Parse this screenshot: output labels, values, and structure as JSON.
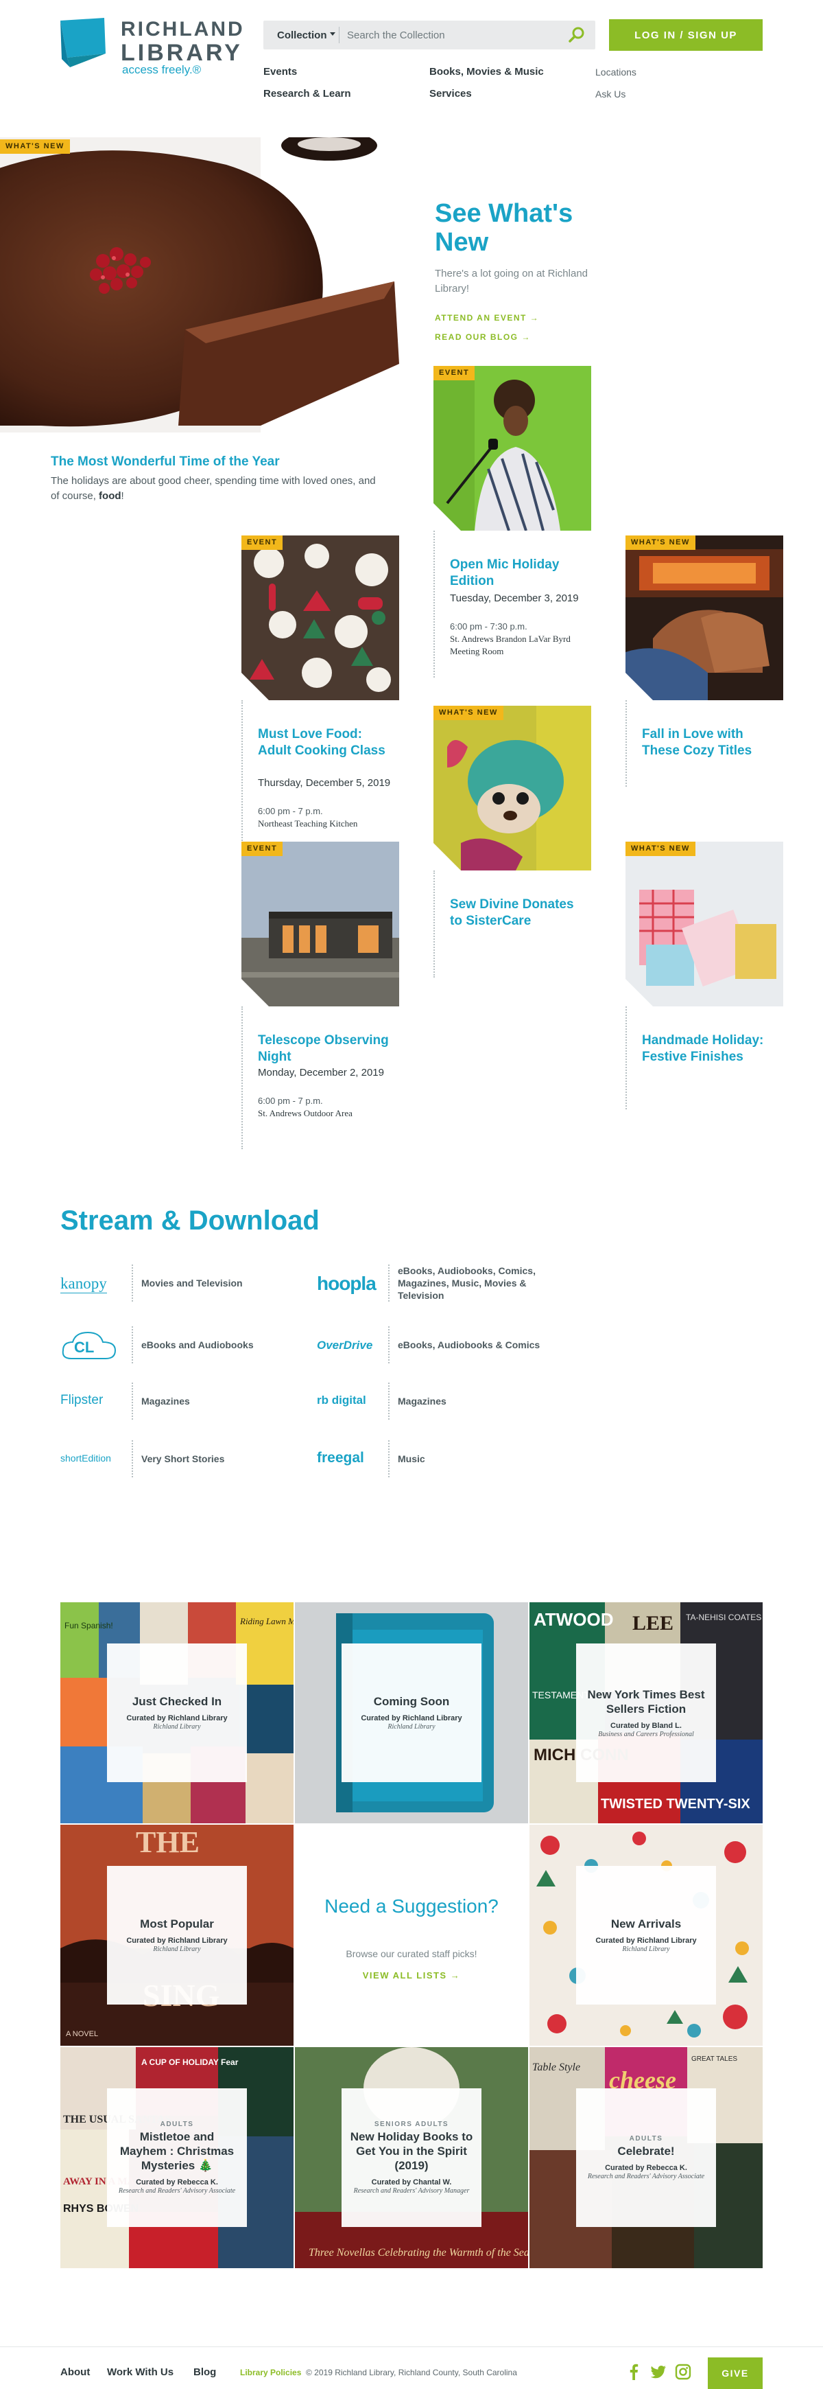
{
  "brand": {
    "name_line1": "RICHLAND",
    "name_line2": "LIBRARY",
    "tagline": "access freely.®",
    "colors": {
      "teal": "#1aa3c6",
      "green": "#8cbc26",
      "badge": "#f2b71b",
      "text": "#2f3a3e"
    }
  },
  "search": {
    "scope_label": "Collection",
    "placeholder": "Search the Collection",
    "icon": "search-icon"
  },
  "login_label": "LOG IN / SIGN UP",
  "nav": {
    "primary": [
      "Events",
      "Books, Movies & Music",
      "Research & Learn",
      "Services"
    ],
    "utility": [
      "Locations",
      "Ask Us"
    ]
  },
  "hero": {
    "badge": "WHAT'S NEW",
    "title": "The Most Wonderful Time of the Year",
    "desc_before": "The holidays are about good cheer, spending time with loved ones, and of course, ",
    "desc_bold": "food",
    "desc_after": "!"
  },
  "see_whats_new": {
    "title": "See What's New",
    "desc": "There's a lot going on at Richland Library!",
    "links": [
      "ATTEND AN EVENT →",
      "READ OUR BLOG →"
    ]
  },
  "cards": [
    {
      "badge": "EVENT",
      "title": "Open Mic Holiday Edition",
      "date": "Tuesday, December 3, 2019",
      "time": "6:00 pm - 7:30 p.m.",
      "location": "St. Andrews Brandon LaVar Byrd Meeting Room"
    },
    {
      "badge": "EVENT",
      "title": "Must Love Food: Adult Cooking Class",
      "date": "Thursday, December 5, 2019",
      "time": "6:00 pm - 7 p.m.",
      "location": "Northeast Teaching Kitchen"
    },
    {
      "badge": "WHAT'S NEW",
      "title": "Fall in Love with These Cozy Titles"
    },
    {
      "badge": "WHAT'S NEW",
      "title": "Sew Divine Donates to SisterCare"
    },
    {
      "badge": "EVENT",
      "title": "Telescope Observing Night",
      "date": "Monday, December 2, 2019",
      "time": "6:00 pm - 7 p.m.",
      "location": "St. Andrews Outdoor Area"
    },
    {
      "badge": "WHAT'S NEW",
      "title": "Handmade Holiday: Festive Finishes"
    }
  ],
  "stream": {
    "title": "Stream & Download",
    "services": [
      {
        "name": "kanopy",
        "desc": "Movies and Television"
      },
      {
        "name": "hoopla",
        "desc": "eBooks, Audiobooks, Comics, Magazines, Music, Movies & Television"
      },
      {
        "name": "CL",
        "desc": "eBooks and Audiobooks"
      },
      {
        "name": "OverDrive",
        "desc": "eBooks, Audiobooks & Comics"
      },
      {
        "name": "Flipster",
        "desc": "Magazines"
      },
      {
        "name": "rb digital",
        "desc": "Magazines"
      },
      {
        "name": "shortEdition",
        "desc": "Very Short Stories"
      },
      {
        "name": "freegal",
        "desc": "Music"
      }
    ]
  },
  "lists": [
    {
      "title": "Just Checked In",
      "curator": "Curated by Richland Library",
      "role": "Richland Library"
    },
    {
      "title": "Coming Soon",
      "curator": "Curated by Richland Library",
      "role": "Richland Library"
    },
    {
      "title": "New York Times Best Sellers Fiction",
      "curator": "Curated by Bland L.",
      "role": "Business and Careers Professional"
    },
    {
      "title": "Most Popular",
      "curator": "Curated by Richland Library",
      "role": "Richland Library"
    },
    {
      "title": "New Arrivals",
      "curator": "Curated by Richland Library",
      "role": "Richland Library"
    },
    {
      "kicker": "ADULTS",
      "title": "Mistletoe and Mayhem : Christmas Mysteries 🎄",
      "curator": "Curated by Rebecca K.",
      "role": "Research and Readers' Advisory Associate"
    },
    {
      "kicker": "SENIORS ADULTS",
      "title": "New Holiday Books to Get You in the Spirit (2019)",
      "curator": "Curated by Chantal W.",
      "role": "Research and Readers' Advisory Manager"
    },
    {
      "kicker": "ADULTS",
      "title": "Celebrate!",
      "curator": "Curated by Rebecca K.",
      "role": "Research and Readers' Advisory Associate"
    }
  ],
  "suggestion": {
    "title": "Need a Suggestion?",
    "sub": "Browse our curated staff picks!",
    "link": "VIEW ALL LISTS →"
  },
  "cover_text": {
    "fun_spanish": "Fun Spanish!",
    "riding_lawn_mower": "Riding Lawn Mower",
    "atwood": "ATWOOD",
    "lee": "LEE",
    "coates": "TA-NEHISI COATES",
    "testaments": "TESTAMENTS",
    "connelly": "MICH CONN",
    "twenty_six": "TWISTED TWENTY-SIX",
    "the": "THE",
    "sing": "SING",
    "novel": "A NOVEL",
    "cup_of_holiday": "A CUP OF HOLIDAY Fear",
    "usual_santas": "THE USUAL SANTAS",
    "away_manger": "AWAY IN A MANGER",
    "rhys_bowen": "RHYS BOWEN",
    "three_novellas": "Three Novellas Celebrating the Warmth of the Season",
    "cheese": "cheese",
    "table_style": "Table Style",
    "great_tales": "GREAT TALES"
  },
  "footer": {
    "nav": [
      "About",
      "Work With Us",
      "Blog"
    ],
    "policies": "Library Policies",
    "copyright": "© 2019 Richland Library, Richland County, South Carolina",
    "give": "GIVE",
    "social": [
      "facebook-icon",
      "twitter-icon",
      "instagram-icon"
    ]
  }
}
